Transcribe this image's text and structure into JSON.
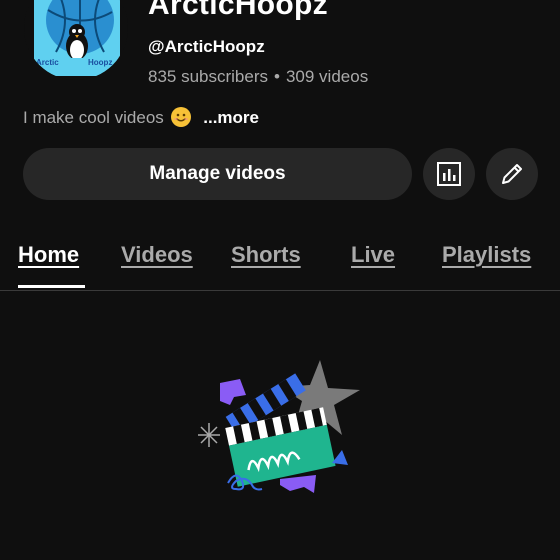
{
  "channel": {
    "name": "ArcticHoopz",
    "handle": "@ArcticHoopz",
    "subscribers": "835 subscribers",
    "videos": "309 videos",
    "separator": "•",
    "description": "I make cool videos",
    "more_label": "...more",
    "avatar_text_left": "Arctic",
    "avatar_text_right": "Hoopz"
  },
  "actions": {
    "manage_label": "Manage videos",
    "analytics_icon": "bar-chart-icon",
    "edit_icon": "pencil-icon"
  },
  "tabs": [
    {
      "label": "Home",
      "active": true
    },
    {
      "label": "Videos",
      "active": false
    },
    {
      "label": "Shorts",
      "active": false
    },
    {
      "label": "Live",
      "active": false
    },
    {
      "label": "Playlists",
      "active": false
    }
  ],
  "colors": {
    "background": "#0f0f0f",
    "button_bg": "#272727",
    "secondary_text": "#aaaaaa",
    "clapper_teal": "#1fb58f",
    "accent_blue": "#3a6ee8",
    "accent_purple": "#8a5cf5",
    "star_gray": "#7a7a7a"
  }
}
